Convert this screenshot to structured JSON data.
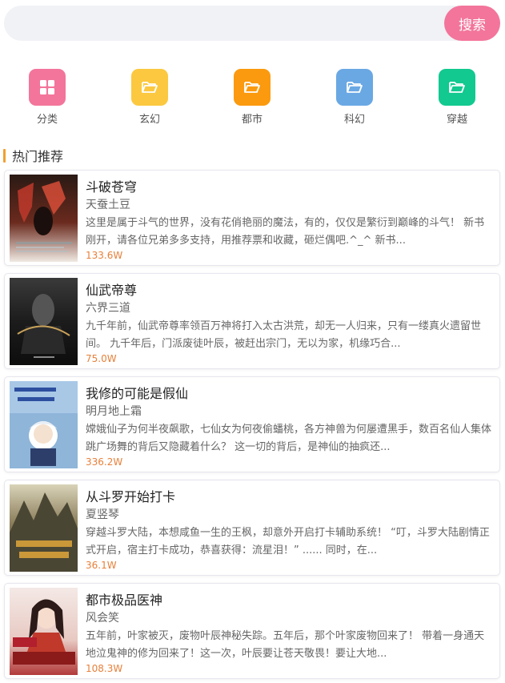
{
  "search": {
    "placeholder": "",
    "button_label": "搜索"
  },
  "categories": [
    {
      "label": "分类",
      "icon": "grid-icon",
      "color": "#f3759b"
    },
    {
      "label": "玄幻",
      "icon": "folder-icon",
      "color": "#fbc840"
    },
    {
      "label": "都市",
      "icon": "folder-icon",
      "color": "#fb9a0e"
    },
    {
      "label": "科幻",
      "icon": "folder-icon",
      "color": "#6aa8e4"
    },
    {
      "label": "穿越",
      "icon": "folder-icon",
      "color": "#12c98f"
    }
  ],
  "section": {
    "title": "热门推荐",
    "accent": "#f0a030"
  },
  "books": [
    {
      "title": "斗破苍穹",
      "author": "天蚕土豆",
      "desc": "这里是属于斗气的世界，没有花俏艳丽的魔法，有的，仅仅是繁衍到巅峰的斗气！ 新书刚开，请各位兄弟多多支持，用推荐票和收藏，砸烂偶吧.^_^ 新书...",
      "hits": "133.6W"
    },
    {
      "title": "仙武帝尊",
      "author": "六界三道",
      "desc": "九千年前，仙武帝尊率领百万神将打入太古洪荒，却无一人归来，只有一缕真火遗留世间。 九千年后，门派废徒叶辰，被赶出宗门，无以为家，机缘巧合...",
      "hits": "75.0W"
    },
    {
      "title": "我修的可能是假仙",
      "author": "明月地上霜",
      "desc": "嫦娥仙子为何半夜飙歌，七仙女为何夜偷蟠桃，各方神兽为何屡遭黑手，数百名仙人集体跳广场舞的背后又隐藏着什么？ 这一切的背后，是神仙的抽疯还...",
      "hits": "336.2W"
    },
    {
      "title": "从斗罗开始打卡",
      "author": "夏竖琴",
      "desc": "穿越斗罗大陆，本想咸鱼一生的王枫，却意外开启打卡辅助系统！ “叮，斗罗大陆剧情正式开启，宿主打卡成功，恭喜获得：流星泪！” ...... 同时，在...",
      "hits": "36.1W"
    },
    {
      "title": "都市极品医神",
      "author": "风会笑",
      "desc": "五年前，叶家被灭，废物叶辰神秘失踪。五年后，那个叶家废物回来了！ 带着一身通天地泣鬼神的修为回来了！这一次，叶辰要让苍天敬畏！要让大地...",
      "hits": "108.3W"
    }
  ]
}
